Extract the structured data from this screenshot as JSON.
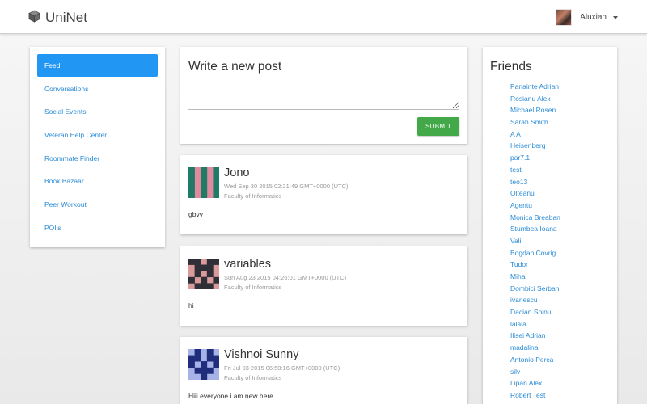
{
  "header": {
    "brand": "UniNet",
    "user_name": "Aluxian"
  },
  "sidebar": {
    "items": [
      {
        "label": "Feed",
        "active": true
      },
      {
        "label": "Conversations"
      },
      {
        "label": "Social Events"
      },
      {
        "label": "Veteran Help Center"
      },
      {
        "label": "Roommate Finder"
      },
      {
        "label": "Book Bazaar"
      },
      {
        "label": "Peer Workout"
      },
      {
        "label": "POI's"
      }
    ]
  },
  "compose": {
    "title": "Write a new post",
    "textarea_value": "",
    "submit_label": "SUBMIT"
  },
  "posts": [
    {
      "author": "Jono",
      "date": "Wed Sep 30 2015 02:21:49 GMT+0000 (UTC)",
      "faculty": "Faculty of Informatics",
      "body": "gbvv",
      "avatar_colors": [
        "#e08aa0",
        "#1f7a66"
      ]
    },
    {
      "author": "variables",
      "date": "Sun Aug 23 2015 04:26:01 GMT+0000 (UTC)",
      "faculty": "Faculty of Informatics",
      "body": "hi",
      "avatar_colors": [
        "#d89a9a",
        "#2f2f37"
      ]
    },
    {
      "author": "Vishnoi Sunny",
      "date": "Fri Jul 03 2015 06:50:16 GMT+0000 (UTC)",
      "faculty": "Faculty of Informatics",
      "body": "Hiii everyone i am new here",
      "avatar_colors": [
        "#a6b2e8",
        "#1f2d7a"
      ]
    }
  ],
  "friends": {
    "title": "Friends",
    "list": [
      "Panainte Adrian",
      "Rosianu Alex",
      "Michael Rosen",
      "Sarah Smith",
      "A A",
      "Heisenberg",
      "par7.1",
      "test",
      "teo13",
      "Olteanu",
      "Agentu",
      "Monica Breaban",
      "Stumbea Ioana",
      "Vali",
      "Bogdan Covrig",
      "Tudor",
      "Mihai",
      "Dombici Serban",
      "ivanescu",
      "Dacian Spinu",
      "lalala",
      "Ilisei Adrian",
      "madalina",
      "Antonio Perca",
      "silv",
      "Lipan Alex",
      "Robert Test"
    ]
  },
  "colors": {
    "accent": "#2196f3",
    "link": "#2a8bd6",
    "submit": "#43a847"
  },
  "icons": {
    "brand": "cube-icon",
    "user_menu": "caret-down-icon"
  }
}
